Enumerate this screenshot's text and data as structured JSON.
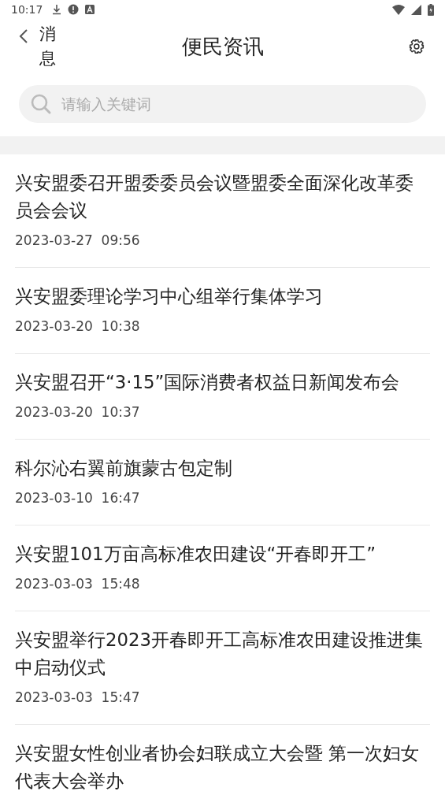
{
  "status_bar": {
    "time": "10:17"
  },
  "header": {
    "back_label": "消息",
    "title": "便民资讯"
  },
  "search": {
    "placeholder": "请输入关键词"
  },
  "news": [
    {
      "title": "兴安盟委召开盟委委员会议暨盟委全面深化改革委员会会议",
      "time": "2023-03-27  09:56"
    },
    {
      "title": "兴安盟委理论学习中心组举行集体学习",
      "time": "2023-03-20  10:38"
    },
    {
      "title": "兴安盟召开“3·15”国际消费者权益日新闻发布会",
      "time": "2023-03-20  10:37"
    },
    {
      "title": "科尔沁右翼前旗蒙古包定制",
      "time": "2023-03-10  16:47"
    },
    {
      "title": "兴安盟101万亩高标准农田建设“开春即开工”",
      "time": "2023-03-03  15:48"
    },
    {
      "title": "兴安盟举行2023开春即开工高标准农田建设推进集中启动仪式",
      "time": "2023-03-03  15:47"
    },
    {
      "title": "兴安盟女性创业者协会妇联成立大会暨 第一次妇女代表大会举办"
    }
  ]
}
